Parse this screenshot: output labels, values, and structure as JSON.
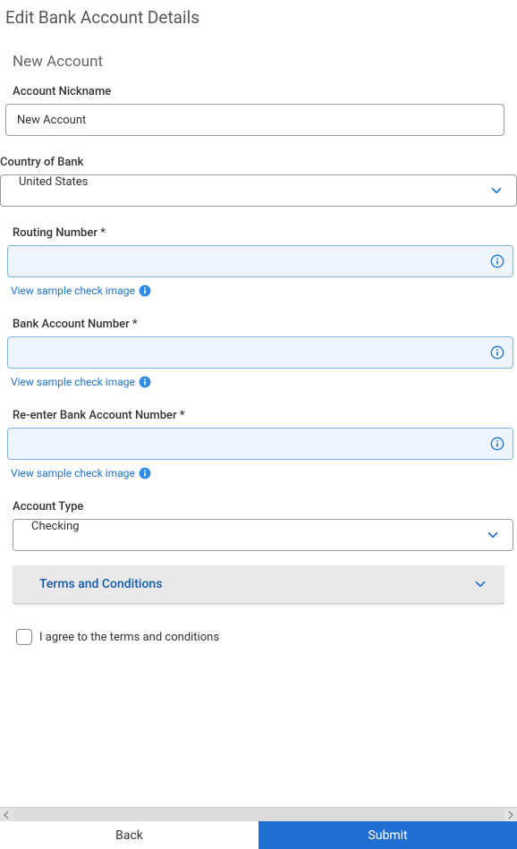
{
  "page_title": "Edit Bank Account Details",
  "section_title": "New Account",
  "fields": {
    "nickname": {
      "label": "Account Nickname",
      "value": "New Account"
    },
    "country": {
      "label": "Country of Bank",
      "value": "United States"
    },
    "routing": {
      "label": "Routing Number *",
      "sample_link": "View sample check image"
    },
    "account": {
      "label": "Bank Account Number *",
      "sample_link": "View sample check image"
    },
    "reenter": {
      "label": "Re-enter Bank Account Number *",
      "sample_link": "View sample check image"
    },
    "account_type": {
      "label": "Account Type",
      "value": "Checking"
    }
  },
  "terms": {
    "title": "Terms and Conditions",
    "agree_text": "I agree to the terms and conditions"
  },
  "buttons": {
    "back": "Back",
    "submit": "Submit"
  },
  "colors": {
    "accent_blue": "#226fd4",
    "light_blue_bg": "#eef4fb",
    "light_blue_border": "#7fb3e8",
    "link_blue": "#1e72d0"
  }
}
